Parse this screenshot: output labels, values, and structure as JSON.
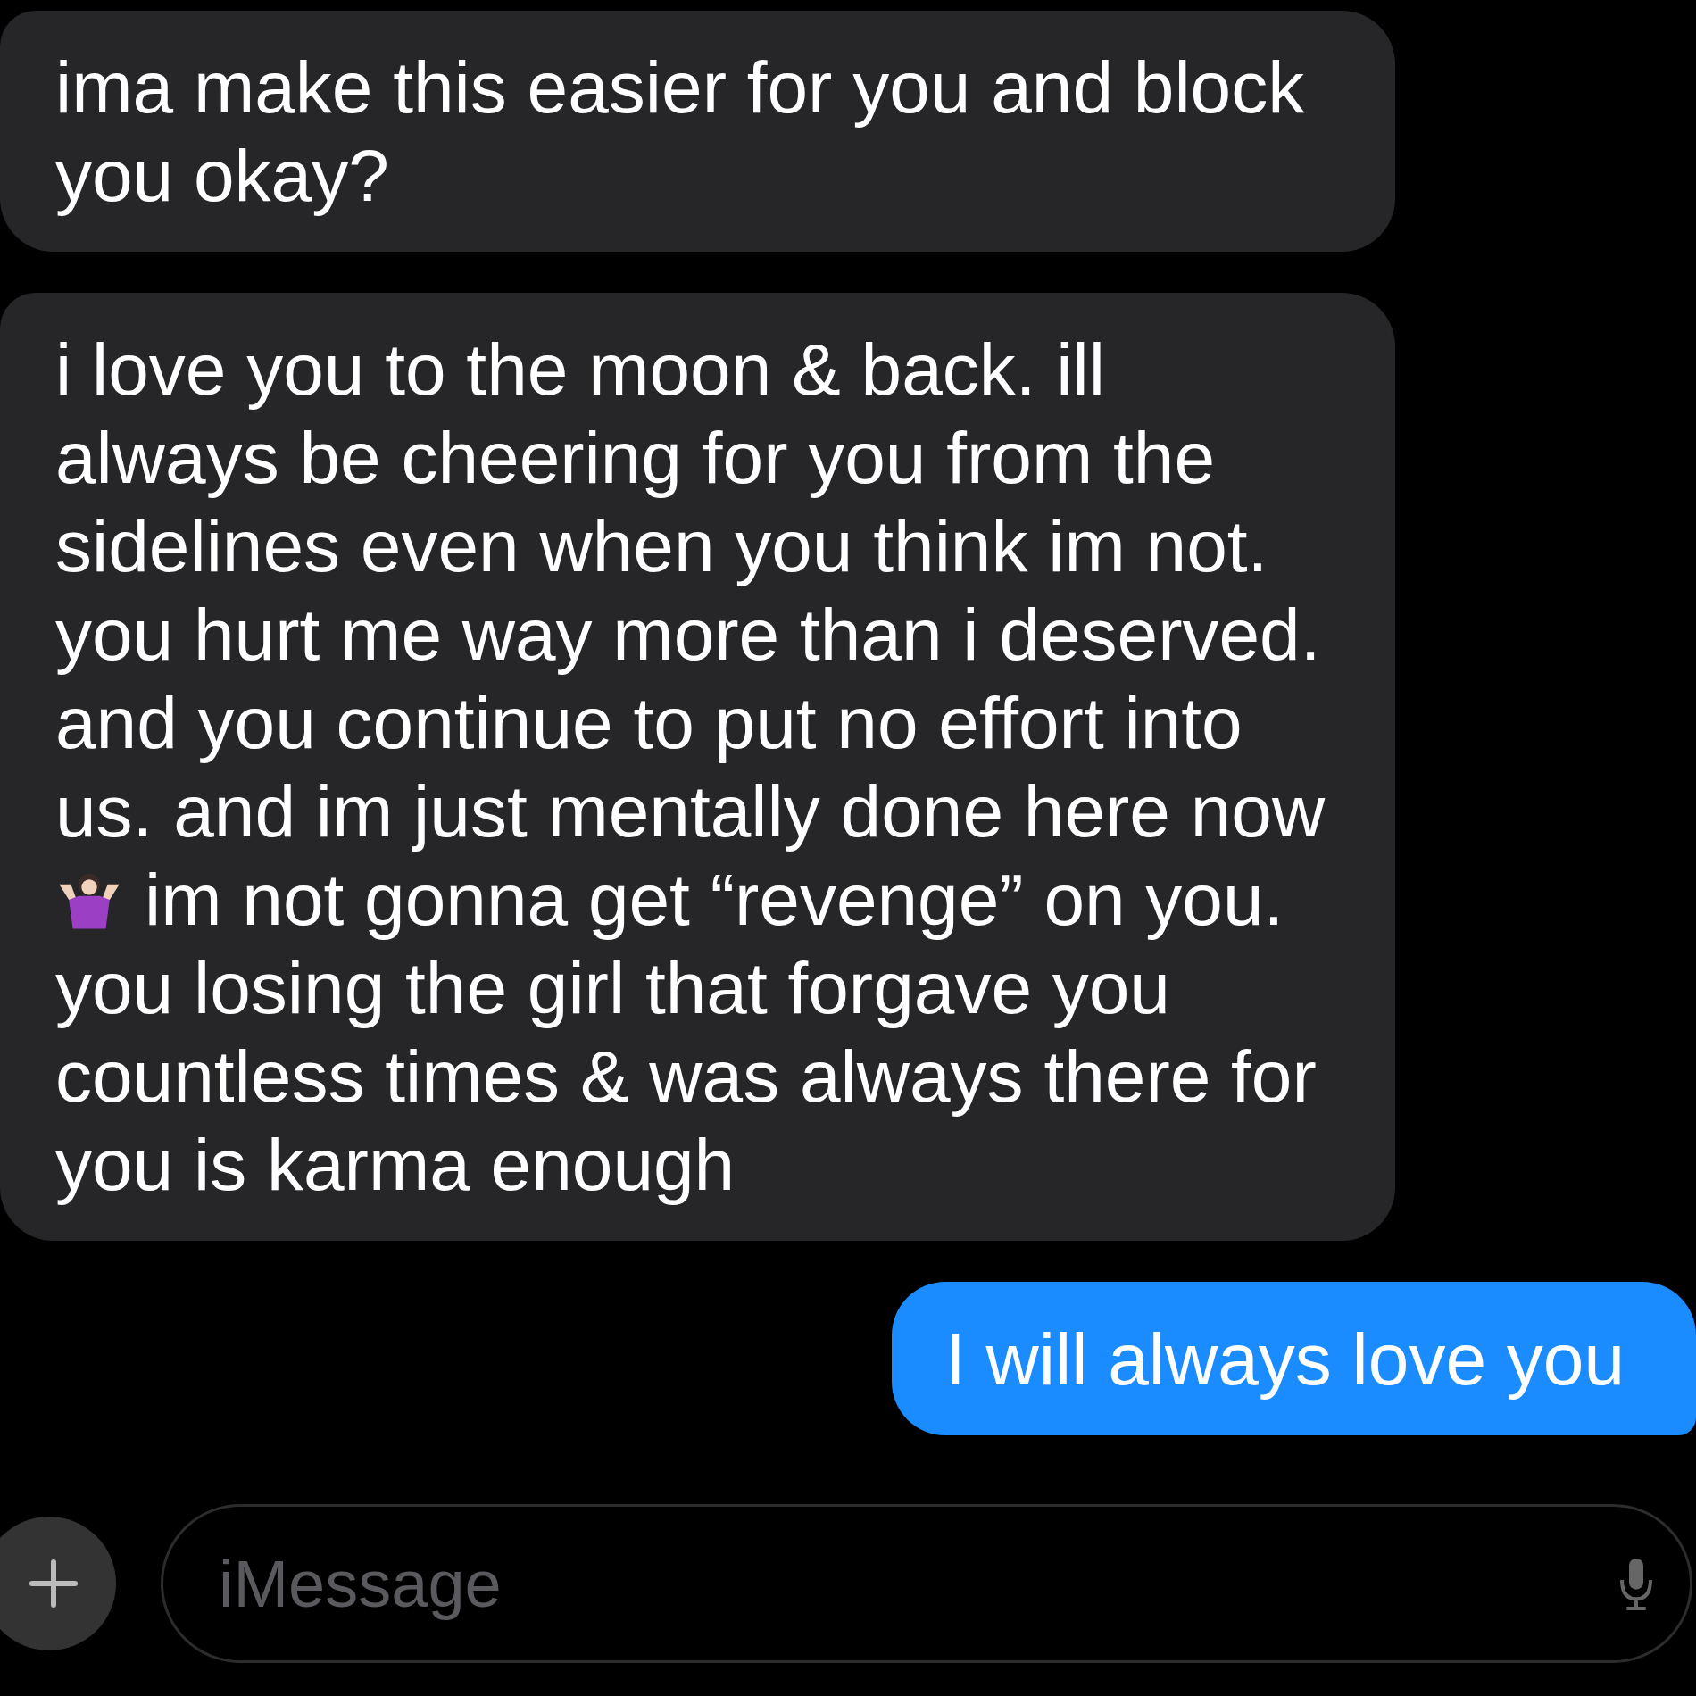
{
  "messages": [
    {
      "kind": "incoming",
      "segments": [
        {
          "kind": "text",
          "text": "ima make this easier for you and block\nyou okay?"
        }
      ]
    },
    {
      "kind": "incoming",
      "segments": [
        {
          "kind": "text",
          "text": "i love you to the moon & back. ill\nalways be cheering for you from the\nsidelines even when you think im not.\nyou hurt me way more than i deserved.\nand you continue to put no effort into\nus. and im just mentally done here now"
        },
        {
          "kind": "shrug_line",
          "text": "im not gonna get “revenge” on you."
        },
        {
          "kind": "text",
          "text": "you losing the girl that forgave you\ncountless times & was always there for\nyou is karma enough"
        }
      ]
    },
    {
      "kind": "outgoing",
      "segments": [
        {
          "kind": "text",
          "text": "I will always love you"
        }
      ]
    }
  ],
  "composer": {
    "placeholder": "iMessage"
  }
}
